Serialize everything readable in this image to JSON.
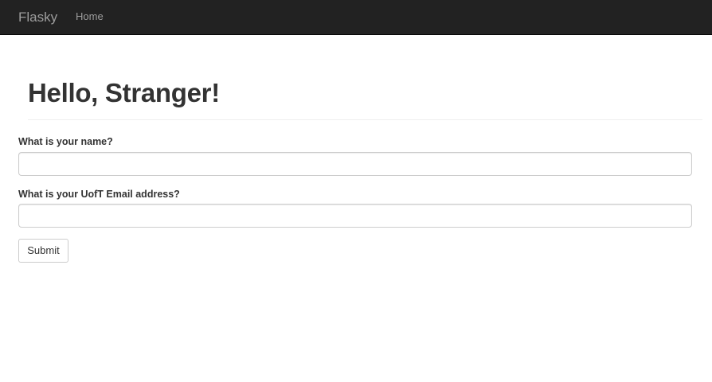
{
  "navbar": {
    "brand": "Flasky",
    "links": [
      {
        "label": "Home"
      }
    ]
  },
  "page_header": {
    "title": "Hello, Stranger!"
  },
  "form": {
    "name_label": "What is your name?",
    "name_value": "",
    "email_label": "What is your UofT Email address?",
    "email_value": "",
    "submit_label": "Submit"
  },
  "colors": {
    "navbar_bg": "#222222",
    "navbar_text": "#9d9d9d",
    "text": "#333333",
    "border": "#cccccc"
  }
}
